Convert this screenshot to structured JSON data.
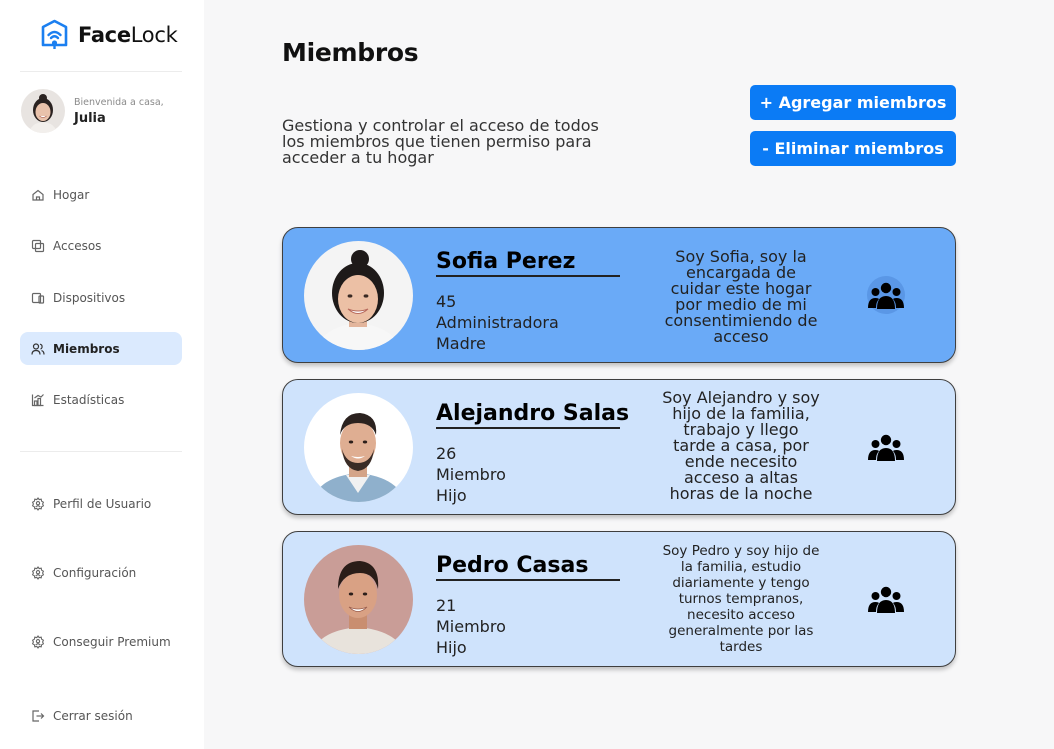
{
  "app": {
    "logo_bold": "Face",
    "logo_regular": "Lock"
  },
  "user": {
    "greeting": "Bienvenida a casa,",
    "name": "Julia"
  },
  "sidebar": {
    "items": [
      {
        "label": "Hogar",
        "icon": "home-icon"
      },
      {
        "label": "Accesos",
        "icon": "access-icon"
      },
      {
        "label": "Dispositivos",
        "icon": "devices-icon"
      },
      {
        "label": "Miembros",
        "icon": "members-icon",
        "active": true
      },
      {
        "label": "Estadísticas",
        "icon": "stats-icon"
      }
    ],
    "settings": [
      {
        "label": "Perfil de Usuario",
        "icon": "gear-icon"
      },
      {
        "label": "Configuración",
        "icon": "gear-icon"
      },
      {
        "label": "Conseguir Premium",
        "icon": "gear-icon"
      }
    ],
    "logout": {
      "label": "Cerrar sesión",
      "icon": "logout-icon"
    }
  },
  "page": {
    "title": "Miembros",
    "description": "Gestiona y controlar el acceso de todos los miembros que tienen permiso para acceder a tu hogar",
    "add_button": "+ Agregar miembros",
    "remove_button": "- Eliminar miembros"
  },
  "members": [
    {
      "name": "Sofia Perez",
      "age": "45",
      "role": "Administradora",
      "relation": "Madre",
      "bio": "Soy Sofia, soy la encargada de cuidar este hogar por medio de mi consentimiendo de acceso",
      "color": "#6aaaf7",
      "icon": "group-icon"
    },
    {
      "name": "Alejandro Salas",
      "age": "26",
      "role": "Miembro",
      "relation": "Hijo",
      "bio": "Soy Alejandro y soy hijo de la familia, trabajo y llego tarde a casa, por ende necesito acceso a altas horas de la noche",
      "color": "#cfe3fc",
      "icon": "group-icon"
    },
    {
      "name": "Pedro Casas",
      "age": "21",
      "role": "Miembro",
      "relation": "Hijo",
      "bio": "Soy Pedro y soy hijo de la familia, estudio diariamente y tengo turnos tempranos, necesito acceso generalmente por las tardes",
      "color": "#cfe3fc",
      "icon": "group-icon"
    }
  ],
  "colors": {
    "accent": "#0b7bf5",
    "active_nav": "#dbeafe"
  }
}
